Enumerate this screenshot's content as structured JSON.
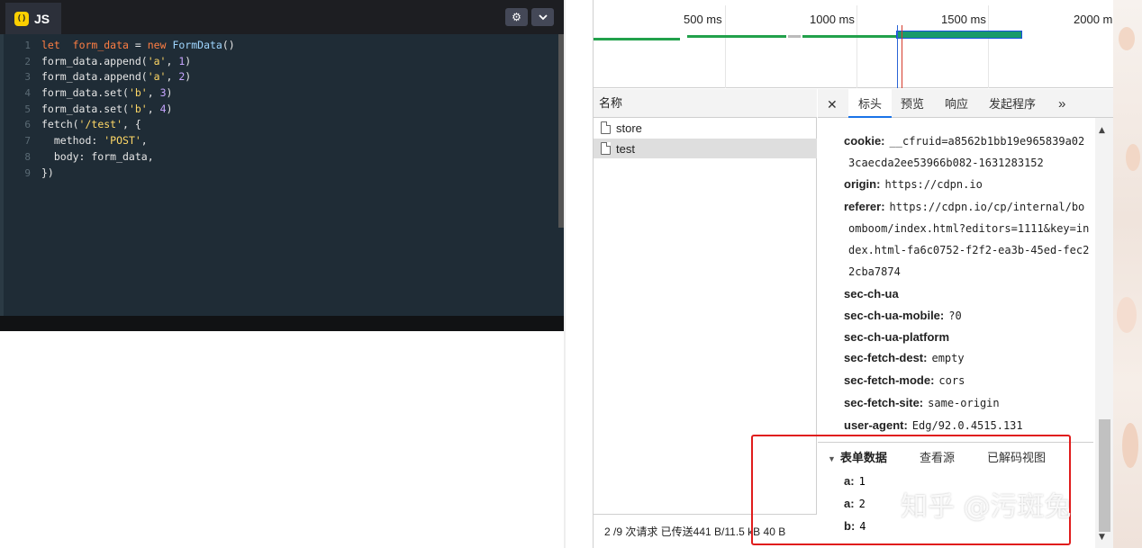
{
  "editor": {
    "tab_label": "JS",
    "logo_glyph": "()",
    "code": [
      {
        "n": "1",
        "parts": [
          [
            "kw",
            "let"
          ],
          [
            "",
            "  "
          ],
          [
            "kw",
            "form_data"
          ],
          [
            "",
            " = "
          ],
          [
            "kw",
            "new"
          ],
          [
            "",
            " "
          ],
          [
            "fn",
            "FormData"
          ],
          [
            "",
            "()"
          ]
        ]
      },
      {
        "n": "2",
        "parts": [
          [
            "",
            "form_data.append("
          ],
          [
            "str",
            "'a'"
          ],
          [
            "",
            ", "
          ],
          [
            "num",
            "1"
          ],
          [
            "",
            ")"
          ]
        ]
      },
      {
        "n": "3",
        "parts": [
          [
            "",
            "form_data.append("
          ],
          [
            "str",
            "'a'"
          ],
          [
            "",
            ", "
          ],
          [
            "num",
            "2"
          ],
          [
            "",
            ")"
          ]
        ]
      },
      {
        "n": "4",
        "parts": [
          [
            "",
            "form_data.set("
          ],
          [
            "str",
            "'b'"
          ],
          [
            "",
            ", "
          ],
          [
            "num",
            "3"
          ],
          [
            "",
            ")"
          ]
        ]
      },
      {
        "n": "5",
        "parts": [
          [
            "",
            "form_data.set("
          ],
          [
            "str",
            "'b'"
          ],
          [
            "",
            ", "
          ],
          [
            "num",
            "4"
          ],
          [
            "",
            ")"
          ]
        ]
      },
      {
        "n": "6",
        "parts": [
          [
            "",
            "fetch("
          ],
          [
            "str",
            "'/test'"
          ],
          [
            "",
            ", {"
          ]
        ]
      },
      {
        "n": "7",
        "parts": [
          [
            "",
            "  method: "
          ],
          [
            "str",
            "'POST'"
          ],
          [
            "",
            ","
          ]
        ]
      },
      {
        "n": "8",
        "parts": [
          [
            "",
            "  body: form_data,"
          ]
        ]
      },
      {
        "n": "9",
        "parts": [
          [
            "",
            "})"
          ]
        ]
      }
    ]
  },
  "timeline": {
    "ticks": [
      "500 ms",
      "1000 ms",
      "1500 ms",
      "2000 m"
    ]
  },
  "network": {
    "column_name": "名称",
    "requests": [
      "store",
      "test"
    ],
    "status": "2 /9 次请求  已传送441 B/11.5 kB  40 B"
  },
  "detail": {
    "tabs": {
      "headers": "标头",
      "preview": "预览",
      "response": "响应",
      "initiator": "发起程序",
      "more": "»"
    },
    "headers": [
      {
        "key": "cookie:",
        "value": "__cfruid=a8562b1bb19e965839a02"
      },
      {
        "key": "",
        "value": "3caecda2ee53966b082-1631283152"
      },
      {
        "key": "origin:",
        "value": "https://cdpn.io"
      },
      {
        "key": "referer:",
        "value": "https://cdpn.io/cp/internal/bo"
      },
      {
        "key": "",
        "value": "omboom/index.html?editors=1111&key=in"
      },
      {
        "key": "",
        "value": "dex.html-fa6c0752-f2f2-ea3b-45ed-fec2"
      },
      {
        "key": "",
        "value": "2cba7874"
      },
      {
        "key": "sec-ch-ua",
        "value": ""
      },
      {
        "key": "sec-ch-ua-mobile:",
        "value": "?0"
      },
      {
        "key": "sec-ch-ua-platform",
        "value": ""
      },
      {
        "key": "sec-fetch-dest:",
        "value": "empty"
      },
      {
        "key": "sec-fetch-mode:",
        "value": "cors"
      },
      {
        "key": "sec-fetch-site:",
        "value": "same-origin"
      },
      {
        "key": "user-agent:",
        "value": "Edg/92.0.4515.131"
      }
    ],
    "form_data": {
      "title": "表单数据",
      "view_source": "查看源",
      "view_decoded": "已解码视图",
      "items": [
        {
          "key": "a:",
          "value": "1"
        },
        {
          "key": "a:",
          "value": "2"
        },
        {
          "key": "b:",
          "value": "4"
        }
      ]
    }
  },
  "watermark": "知乎 @污斑兔",
  "colors": {
    "highlight_box": "#e01c1c",
    "timeline_bar": "#22a14b",
    "editor_bg": "#1f2c36"
  }
}
